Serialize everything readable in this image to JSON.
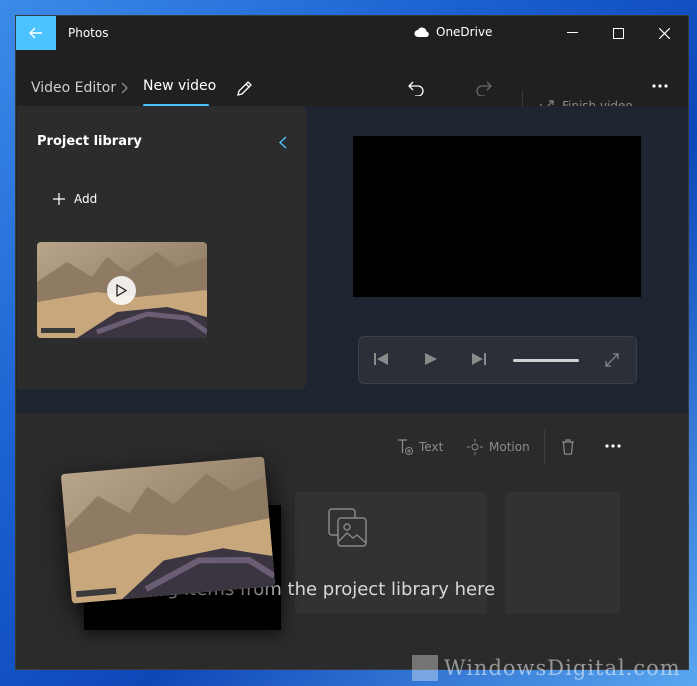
{
  "titlebar": {
    "app_name": "Photos",
    "cloud_label": "OneDrive"
  },
  "toolbar": {
    "breadcrumb_parent": "Video Editor",
    "project_name": "New video",
    "finish_label": "Finish video"
  },
  "library": {
    "title": "Project library",
    "add_label": "Add"
  },
  "timeline": {
    "text_label": "Text",
    "motion_label": "Motion",
    "drop_hint": "g items from the project library here"
  },
  "watermark": {
    "text": "WindowsDigital.com"
  },
  "colors": {
    "accent": "#4cc2ff",
    "window_bg": "#202020",
    "panel_bg": "#2c2c2c"
  }
}
